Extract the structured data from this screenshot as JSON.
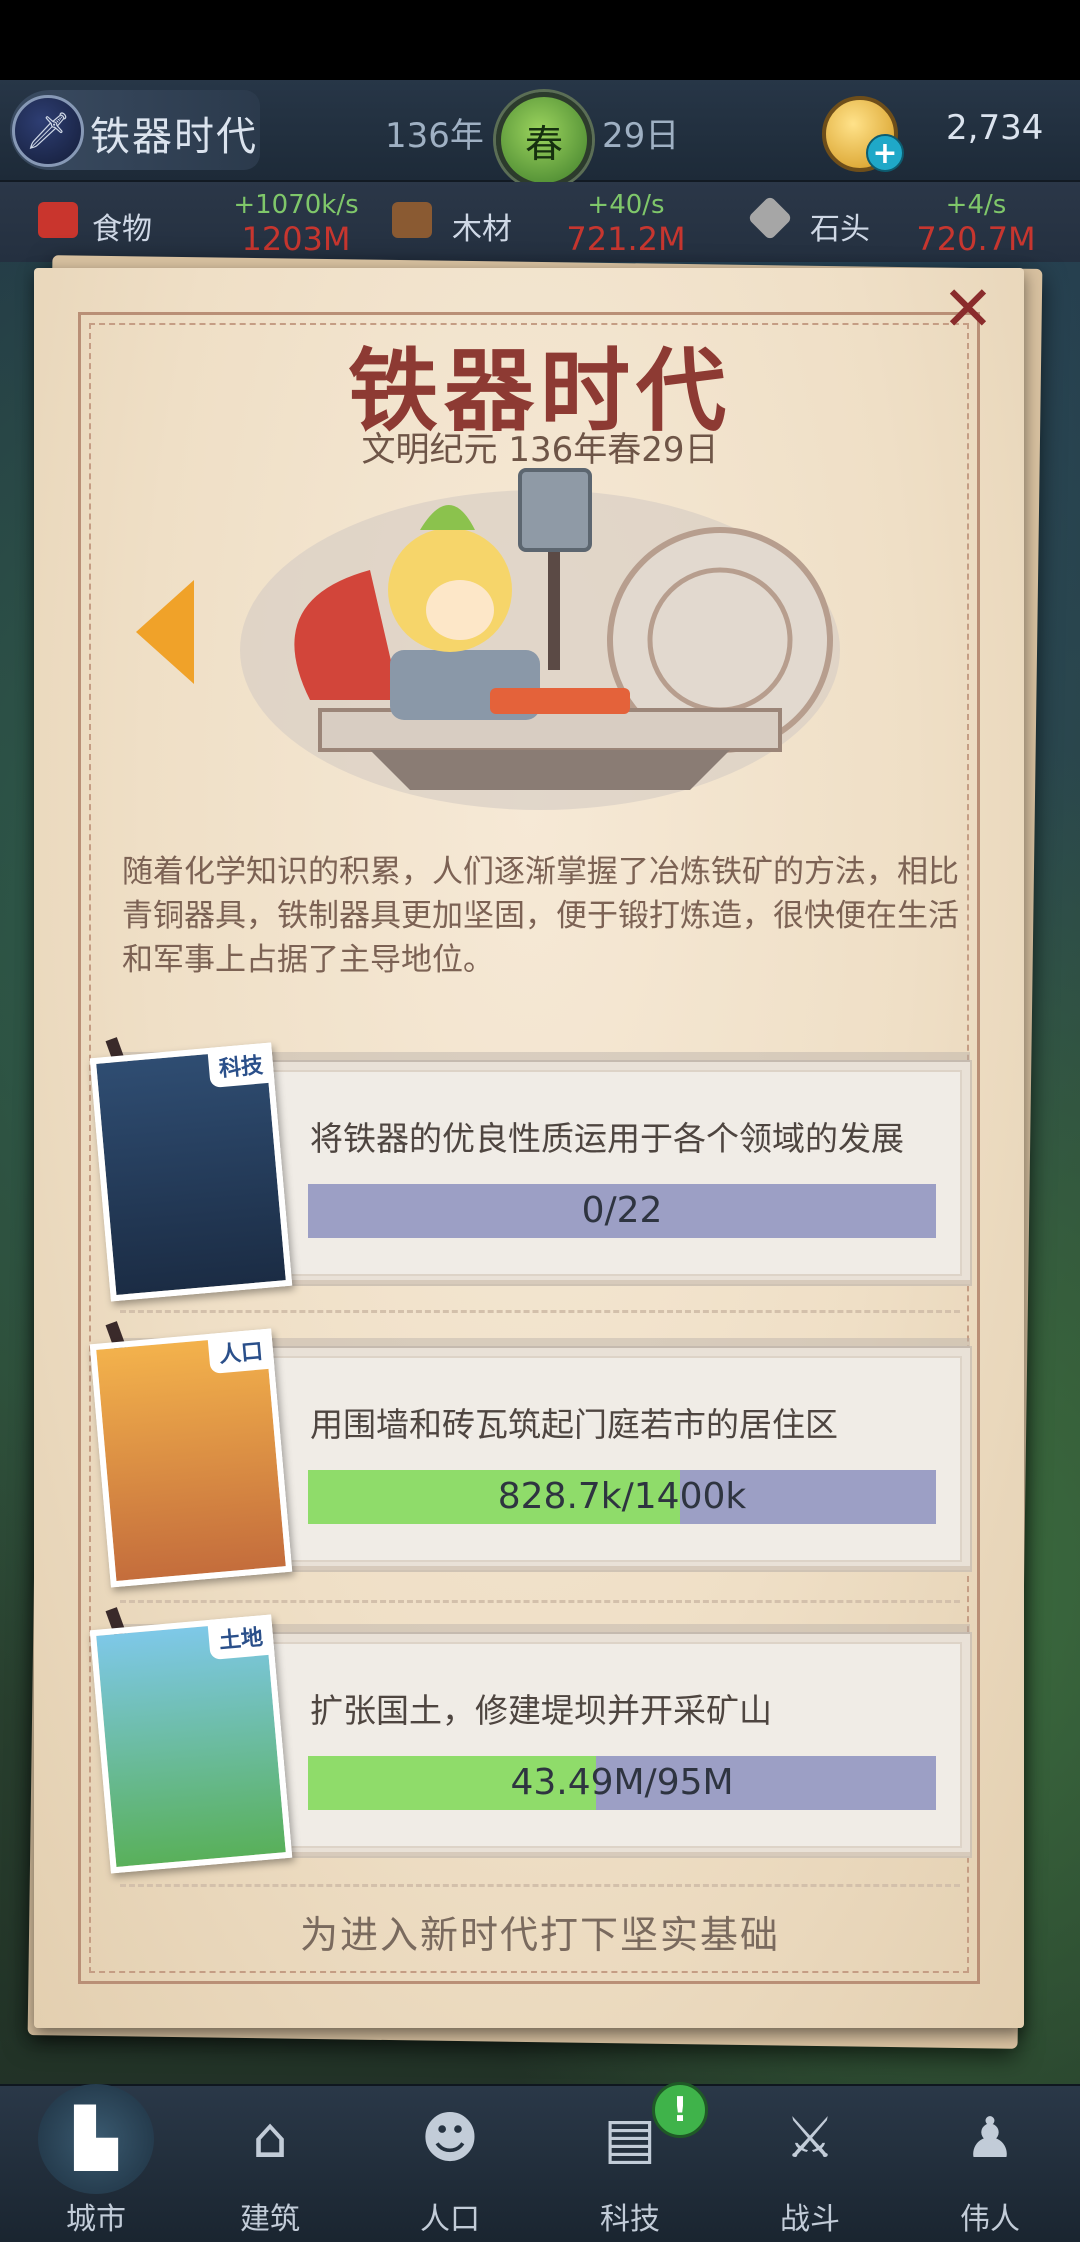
{
  "topbar": {
    "era_name": "铁器时代",
    "year": "136年",
    "season": "春",
    "day": "29日",
    "coins": "2,734"
  },
  "resources": [
    {
      "label": "食物",
      "rate": "+1070k/s",
      "total": "1203M",
      "icon": "meat-icon",
      "color": "#c9352d"
    },
    {
      "label": "木材",
      "rate": "+40/s",
      "total": "721.2M",
      "icon": "wood-icon",
      "color": "#8a5a32"
    },
    {
      "label": "石头",
      "rate": "+4/s",
      "total": "720.7M",
      "icon": "stone-icon",
      "color": "#a6a6a6"
    }
  ],
  "popup": {
    "title": "铁器时代",
    "subtitle": "文明纪元 136年春29日",
    "description": "随着化学知识的积累，人们逐渐掌握了冶炼铁矿的方法，相比青铜器具，铁制器具更加坚固，便于锻打炼造，很快便在生活和军事上占据了主导地位。",
    "tasks": [
      {
        "tag": "科技",
        "text": "将铁器的优良性质运用于各个领域的发展",
        "progress_text": "0/22",
        "progress": 0
      },
      {
        "tag": "人口",
        "text": "用围墙和砖瓦筑起门庭若市的居住区",
        "progress_text": "828.7k/1400k",
        "progress": 0.592
      },
      {
        "tag": "土地",
        "text": "扩张国土，修建堤坝并开采矿山",
        "progress_text": "43.49M/95M",
        "progress": 0.458
      }
    ],
    "footer": "为进入新时代打下坚实基础"
  },
  "bottom_nav": [
    {
      "label": "城市",
      "icon": "castle-icon",
      "active": true
    },
    {
      "label": "建筑",
      "icon": "house-icon",
      "active": false
    },
    {
      "label": "人口",
      "icon": "person-icon",
      "active": false
    },
    {
      "label": "科技",
      "icon": "book-icon",
      "active": false,
      "badge": "!"
    },
    {
      "label": "战斗",
      "icon": "swords-icon",
      "active": false
    },
    {
      "label": "伟人",
      "icon": "bust-icon",
      "active": false
    }
  ]
}
